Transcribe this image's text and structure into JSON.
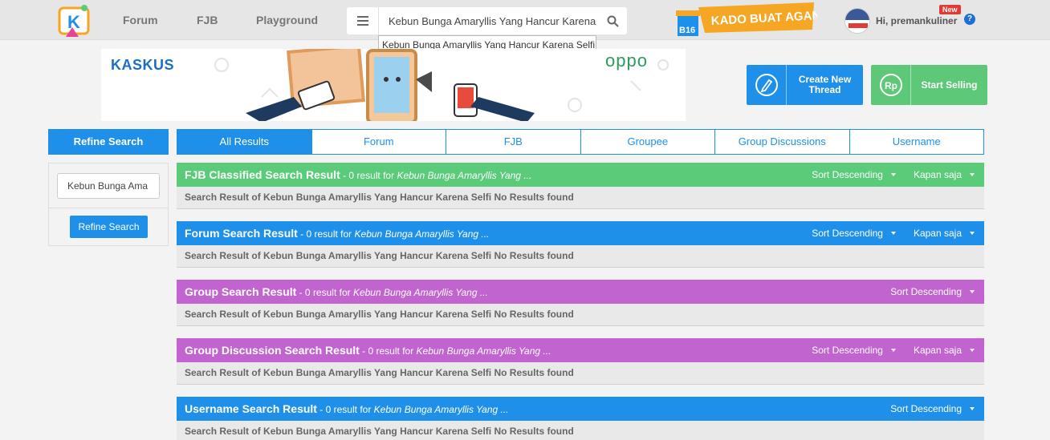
{
  "header": {
    "nav": [
      "Forum",
      "FJB",
      "Playground"
    ],
    "search_value": "Kebun Bunga Amaryllis Yang Hancur Karena Selfi",
    "autocomplete": "Kebun Bunga Amaryllis Yang Hancur Karena Selfi",
    "kado_label": "KADO BUAT AGAN",
    "kado_badge": "B16",
    "greeting": "Hi, premankuliner",
    "new_badge": "New",
    "help": "?"
  },
  "banner": {
    "left_brand": "KASKUS",
    "right_brand": "oppo"
  },
  "actions": {
    "create_thread": "Create New Thread",
    "start_selling": "Start Selling"
  },
  "sidebar": {
    "title": "Refine Search",
    "input_value": "Kebun Bunga Ama",
    "button": "Refine Search"
  },
  "tabs": [
    "All Results",
    "Forum",
    "FJB",
    "Groupee",
    "Group Discussions",
    "Username"
  ],
  "sections": [
    {
      "title": "FJB Classified Search Result",
      "meta": " - 0 result for ",
      "query": "Kebun Bunga Amaryllis Yang ...",
      "sort": "Sort Descending",
      "time": "Kapan saja",
      "body": "Search Result of Kebun Bunga Amaryllis Yang Hancur Karena Selfi No Results found",
      "color": "#5acb79"
    },
    {
      "title": "Forum Search Result",
      "meta": " - 0 result for ",
      "query": "Kebun Bunga Amaryllis Yang ...",
      "sort": "Sort Descending",
      "time": "Kapan saja",
      "body": "Search Result of Kebun Bunga Amaryllis Yang Hancur Karena Selfi No Results found",
      "color": "#1e90ea"
    },
    {
      "title": "Group Search Result",
      "meta": " - 0 result for ",
      "query": "Kebun Bunga Amaryllis Yang ...",
      "sort": "Sort Descending",
      "time": "",
      "body": "Search Result of Kebun Bunga Amaryllis Yang Hancur Karena Selfi No Results found",
      "color": "#c264cf"
    },
    {
      "title": "Group Discussion Search Result",
      "meta": " - 0 result for ",
      "query": "Kebun Bunga Amaryllis Yang ...",
      "sort": "Sort Descending",
      "time": "Kapan saja",
      "body": "Search Result of Kebun Bunga Amaryllis Yang Hancur Karena Selfi No Results found",
      "color": "#c264cf"
    },
    {
      "title": "Username Search Result",
      "meta": " - 0 result for ",
      "query": "Kebun Bunga Amaryllis Yang ...",
      "sort": "Sort Descending",
      "time": "",
      "body": "Search Result of Kebun Bunga Amaryllis Yang Hancur Karena Selfi No Results found",
      "color": "#1e90ea"
    }
  ]
}
